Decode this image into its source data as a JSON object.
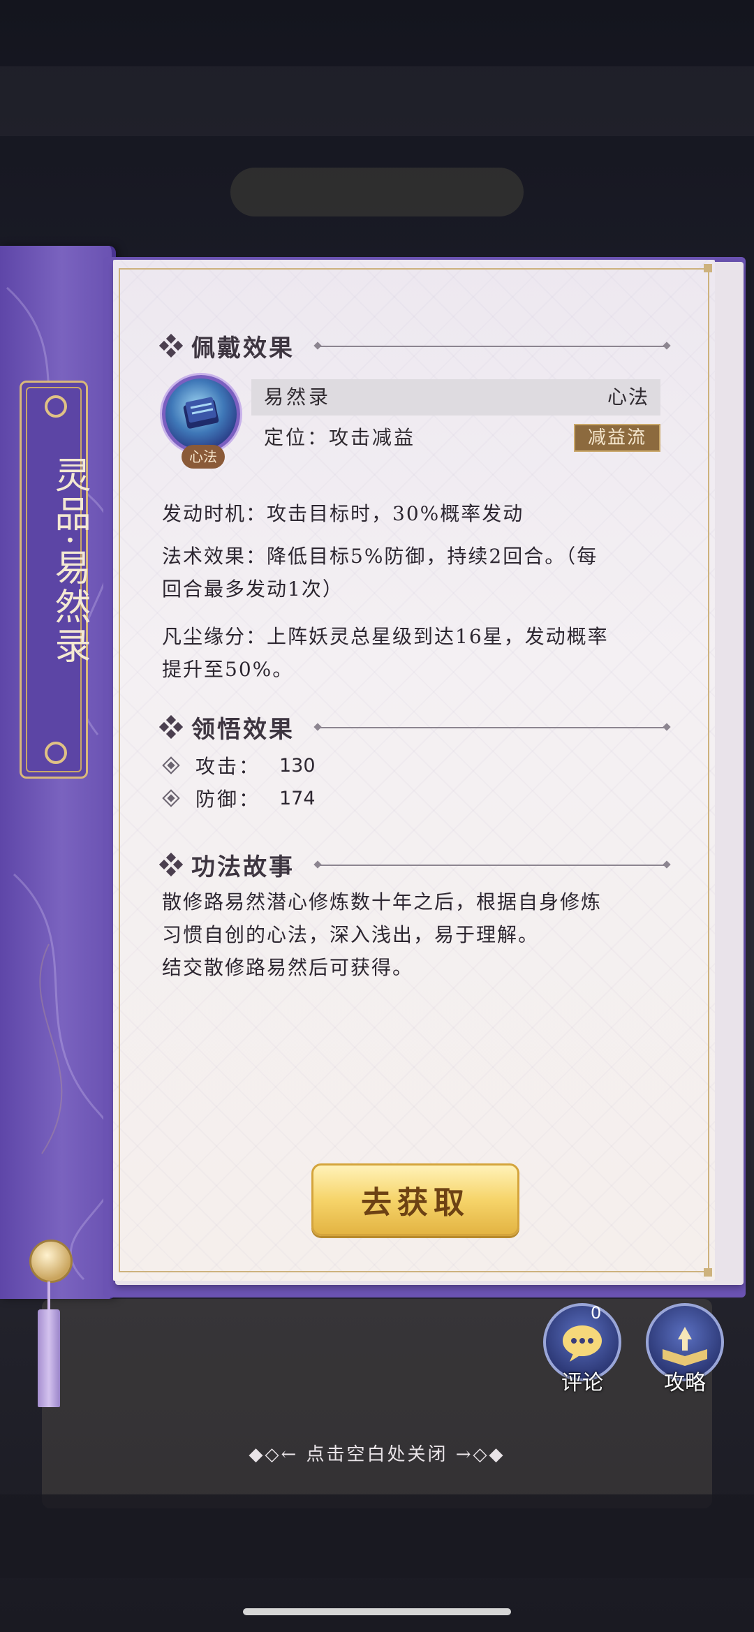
{
  "spine": {
    "title": "灵品·易然录"
  },
  "sections": {
    "wear_title": "佩戴效果",
    "comprehend_title": "领悟效果",
    "story_title": "功法故事"
  },
  "item": {
    "name": "易然录",
    "type": "心法",
    "badge": "心法",
    "role": "定位：攻击减益",
    "tag": "减益流"
  },
  "effects": {
    "trigger": "发动时机：攻击目标时，30%概率发动",
    "spell_line1": "法术效果：降低目标5%防御，持续2回合。（每",
    "spell_line2": "回合最多发动1次）",
    "fate_line1": "凡尘缘分：上阵妖灵总星级到达16星，发动概率",
    "fate_line2": "提升至50%。"
  },
  "stats": [
    {
      "label": "攻击：",
      "value": "130"
    },
    {
      "label": "防御：",
      "value": "174"
    }
  ],
  "story": {
    "line1": "散修路易然潜心修炼数十年之后，根据自身修炼",
    "line2": "习惯自创的心法，深入浅出，易于理解。",
    "line3": "结交散修路易然后可获得。"
  },
  "buttons": {
    "obtain": "去获取",
    "comment": "评论",
    "comment_count": "0",
    "guide": "攻略"
  },
  "hint": "◆◇← 点击空白处关闭 →◇◆",
  "colors": {
    "spine_purple": "#6a52b2",
    "gold": "#cdb27d",
    "tag_brown": "#8c6a3e"
  }
}
